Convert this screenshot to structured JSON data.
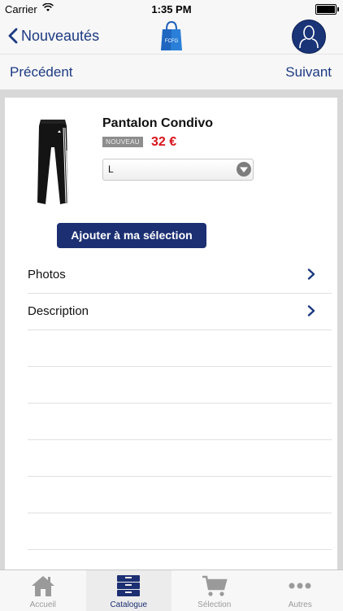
{
  "status_bar": {
    "carrier": "Carrier",
    "time": "1:35 PM"
  },
  "nav": {
    "back_label": "Nouveautés",
    "logo_text": "FCFG"
  },
  "pager": {
    "prev_label": "Précédent",
    "next_label": "Suivant"
  },
  "product": {
    "name": "Pantalon Condivo",
    "badge": "NOUVEAU",
    "price": "32 €",
    "size_selected": "L",
    "add_button": "Ajouter à ma sélection"
  },
  "rows": [
    {
      "label": "Photos"
    },
    {
      "label": "Description"
    }
  ],
  "tabs": [
    {
      "label": "Accueil",
      "icon": "home-icon"
    },
    {
      "label": "Catalogue",
      "icon": "catalogue-icon"
    },
    {
      "label": "Sélection",
      "icon": "cart-icon"
    },
    {
      "label": "Autres",
      "icon": "more-icon"
    }
  ],
  "colors": {
    "accent": "#1c3a82",
    "button": "#1c2f72",
    "price": "#d8131b"
  }
}
